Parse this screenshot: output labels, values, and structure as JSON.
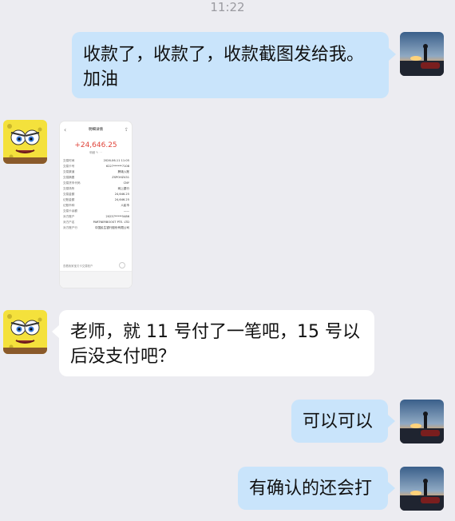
{
  "status_time": "11:22",
  "messages": [
    {
      "id": "m1",
      "side": "right",
      "text": "收款了，收款了，收款截图发给我。加油"
    },
    {
      "id": "m2",
      "side": "left",
      "type": "image"
    },
    {
      "id": "m3",
      "side": "left",
      "text": "老师，就 11 号付了一笔吧，15 号以后没支付吧？"
    },
    {
      "id": "m4",
      "side": "right",
      "text": "可以可以"
    },
    {
      "id": "m5",
      "side": "right",
      "text": "有确认的还会打"
    }
  ],
  "receipt": {
    "title": "明细详情",
    "amount": "+24,646.25",
    "sub": "明细 ✎ ⋯",
    "rows": [
      {
        "label": "交易时间",
        "value": "2026-06-11 11:05"
      },
      {
        "label": "交易卡号",
        "value": "6227******7108"
      },
      {
        "label": "交易渠道",
        "value": "跨境入账"
      },
      {
        "label": "交易摘要",
        "value": "ZSPOHZ431"
      },
      {
        "label": "交易货币代码",
        "value": "CNY"
      },
      {
        "label": "交易场所",
        "value": "网上银行"
      },
      {
        "label": "交易金额",
        "value": "24,646.25"
      },
      {
        "label": "记账金额",
        "value": "24,646.25"
      },
      {
        "label": "记账币种",
        "value": "人民币"
      },
      {
        "label": "交易卡余额",
        "value": "——"
      },
      {
        "label": "对方账户",
        "value": "20237*****5486"
      },
      {
        "label": "对方户名",
        "value": "PARTNERBOOST PTE. LTD"
      },
      {
        "label": "对方账户行",
        "value": "中国民生银行股份有限公司"
      }
    ],
    "note": "查看我家宝贝卡交易账户"
  },
  "colors": {
    "right_bubble": "#c9e4fb",
    "left_bubble": "#ffffff",
    "background": "#ececf1",
    "amount": "#e0443a"
  }
}
